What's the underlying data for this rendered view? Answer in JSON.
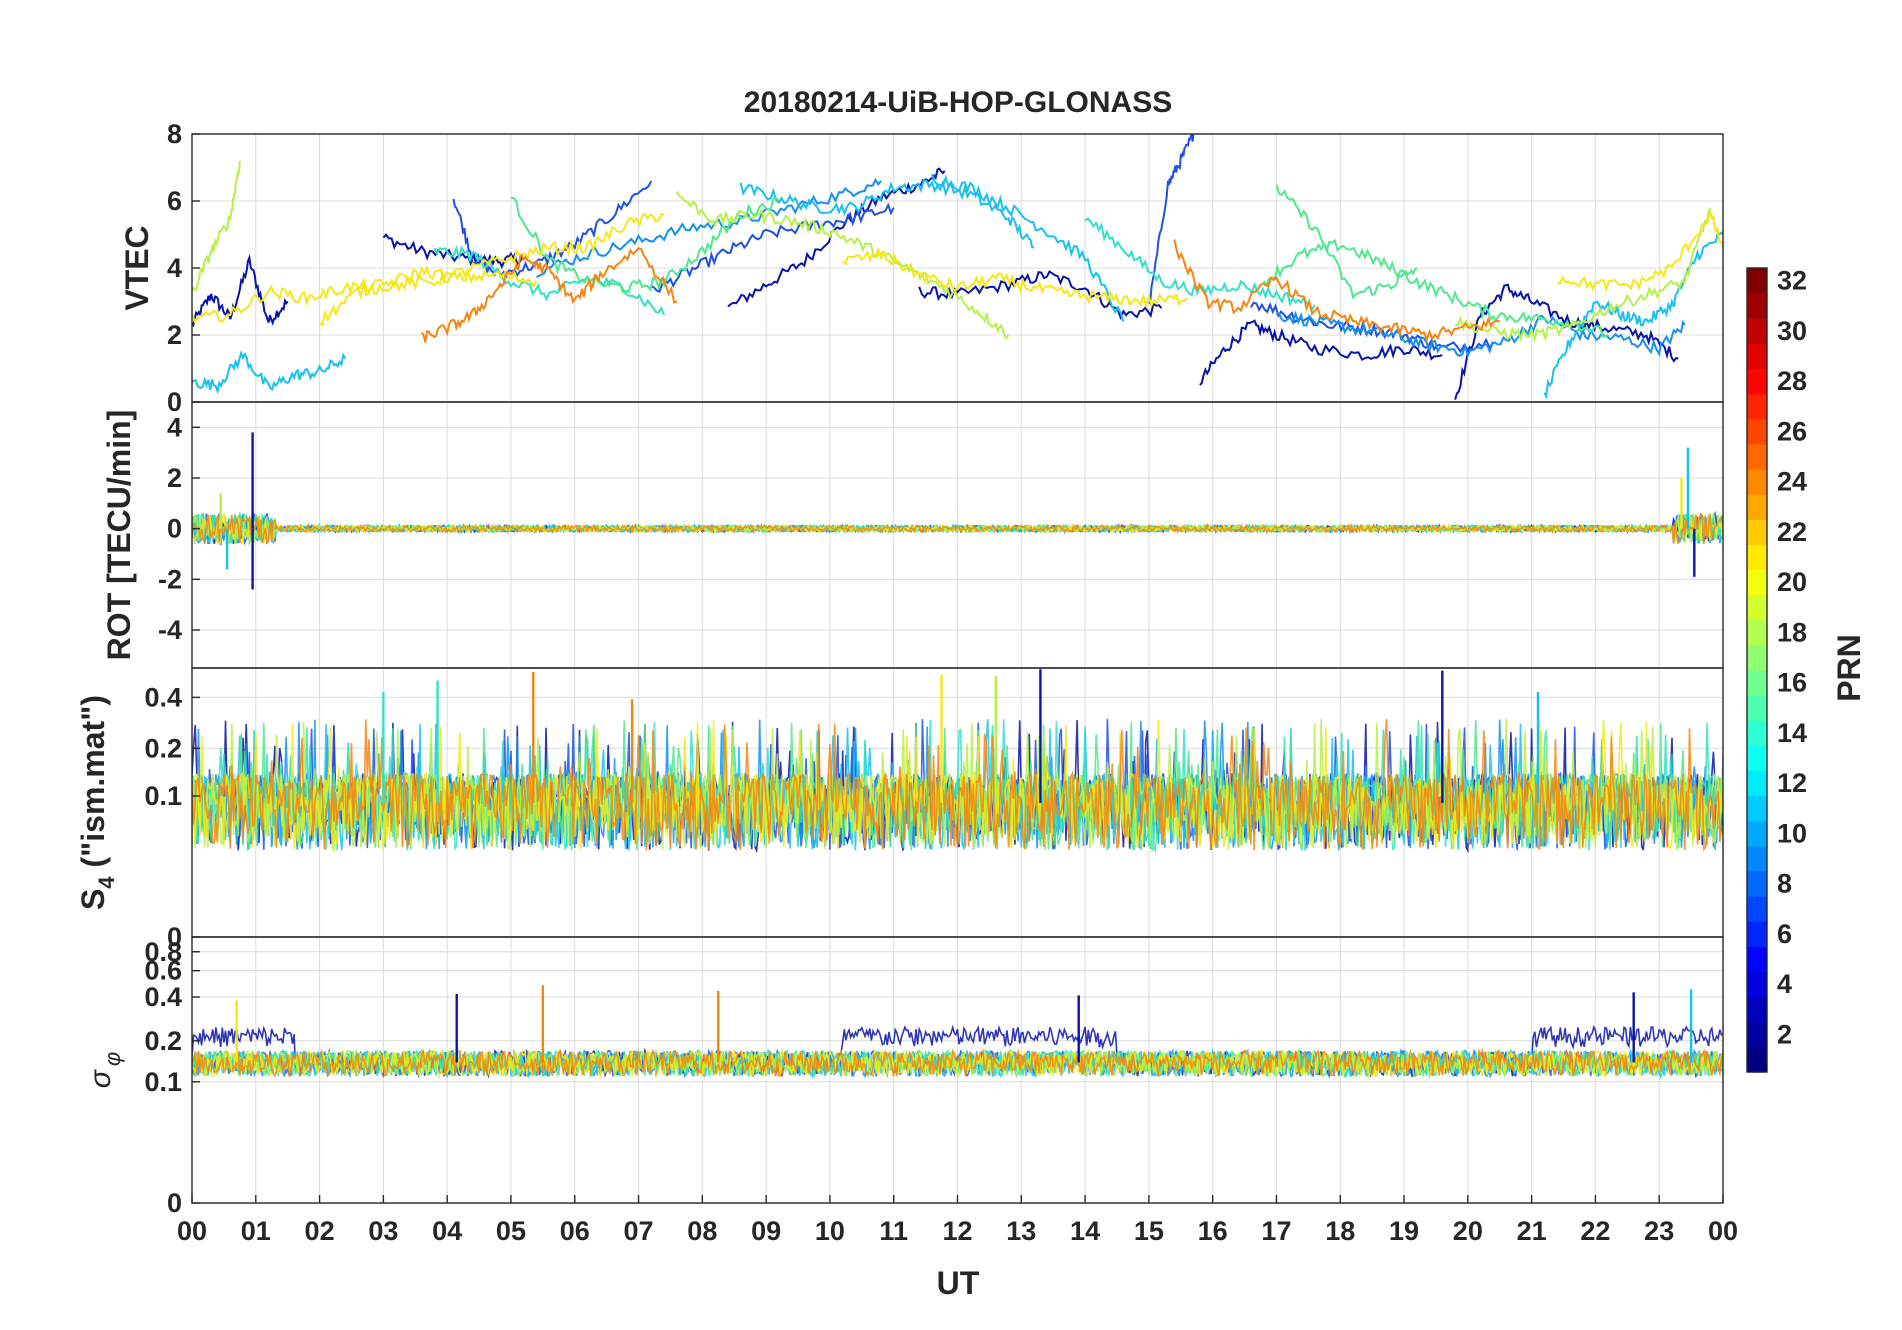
{
  "chart_data": {
    "type": "line",
    "title": "20180214-UiB-HOP-GLONASS",
    "xlabel": "UT",
    "x_ticks": [
      "00",
      "01",
      "02",
      "03",
      "04",
      "05",
      "06",
      "07",
      "08",
      "09",
      "10",
      "11",
      "12",
      "13",
      "14",
      "15",
      "16",
      "17",
      "18",
      "19",
      "20",
      "21",
      "22",
      "23",
      "00"
    ],
    "xlim": [
      0,
      24
    ],
    "colorbar": {
      "label": "PRN",
      "range": [
        1,
        32
      ],
      "ticks": [
        2,
        4,
        6,
        8,
        10,
        12,
        14,
        16,
        18,
        20,
        22,
        24,
        26,
        28,
        30,
        32
      ],
      "colormap": "jet"
    },
    "panels": [
      {
        "id": "vtec",
        "ylabel": "VTEC",
        "ylim": [
          0,
          8
        ],
        "yticks": [
          0,
          2,
          4,
          6,
          8
        ],
        "series": [
          {
            "prn": 2,
            "color": "#0a14a8",
            "x": [
              0.0,
              0.3,
              0.6,
              0.9,
              1.2,
              1.5
            ],
            "y": [
              2.3,
              3.2,
              2.5,
              4.2,
              2.4,
              3.0
            ]
          },
          {
            "prn": 3,
            "color": "#0a14a8",
            "x": [
              3.0,
              3.6,
              4.2,
              4.8,
              5.2
            ],
            "y": [
              4.9,
              4.5,
              4.3,
              4.2,
              4.3
            ]
          },
          {
            "prn": 4,
            "color": "#0a14a8",
            "x": [
              8.4,
              9.0,
              9.6,
              10.2,
              10.8,
              11.4,
              11.8
            ],
            "y": [
              2.8,
              3.5,
              4.2,
              5.3,
              6.1,
              6.5,
              6.9
            ]
          },
          {
            "prn": 5,
            "color": "#0a14a8",
            "x": [
              11.4,
              12.0,
              12.8,
              13.4,
              14.0,
              14.6,
              15.2
            ],
            "y": [
              3.3,
              3.2,
              3.5,
              3.8,
              3.4,
              2.6,
              2.8
            ]
          },
          {
            "prn": 3,
            "color": "#0a14a8",
            "x": [
              15.8,
              16.2,
              16.6,
              17.0,
              17.6,
              18.4,
              19.0,
              19.6
            ],
            "y": [
              0.6,
              1.6,
              2.3,
              2.0,
              1.6,
              1.4,
              1.6,
              1.4
            ]
          },
          {
            "prn": 2,
            "color": "#0a14a8",
            "x": [
              19.8,
              20.2,
              20.6,
              21.0,
              21.6,
              22.2,
              22.8,
              23.3
            ],
            "y": [
              0.1,
              2.6,
              3.4,
              3.0,
              2.4,
              2.2,
              2.0,
              1.3
            ]
          },
          {
            "prn": 7,
            "color": "#1f4fe6",
            "x": [
              4.1,
              4.4,
              4.8,
              5.4,
              6.0,
              6.6,
              7.2
            ],
            "y": [
              6.1,
              4.3,
              3.8,
              4.1,
              4.7,
              5.6,
              6.6
            ]
          },
          {
            "prn": 7,
            "color": "#1f4fe6",
            "x": [
              7.2,
              7.8,
              8.4,
              9.0,
              9.8,
              10.4,
              11.0
            ],
            "y": [
              3.3,
              3.9,
              4.5,
              5.0,
              5.3,
              5.5,
              5.8
            ]
          },
          {
            "prn": 6,
            "color": "#1f4fe6",
            "x": [
              15.0,
              15.3,
              15.5,
              15.7
            ],
            "y": [
              2.8,
              6.5,
              7.2,
              8.0
            ]
          },
          {
            "prn": 7,
            "color": "#1f4fe6",
            "x": [
              16.6,
              17.2,
              17.8,
              18.4,
              19.0,
              19.6,
              20.4
            ],
            "y": [
              3.0,
              2.6,
              2.3,
              2.2,
              2.0,
              1.6,
              1.8
            ]
          },
          {
            "prn": 9,
            "color": "#1590f0",
            "x": [
              5.4,
              6.2,
              7.0,
              7.8,
              8.6,
              9.4,
              10.2,
              10.8
            ],
            "y": [
              3.9,
              4.4,
              4.8,
              5.2,
              5.4,
              5.8,
              6.2,
              6.6
            ]
          },
          {
            "prn": 9,
            "color": "#1590f0",
            "x": [
              17.0,
              17.6,
              18.2,
              18.8,
              19.4,
              20.0,
              20.6,
              21.2,
              21.8,
              22.4,
              23.0,
              23.4
            ],
            "y": [
              2.6,
              2.4,
              2.2,
              2.0,
              1.7,
              1.5,
              1.8,
              2.5,
              2.0,
              1.9,
              1.6,
              2.3
            ]
          },
          {
            "prn": 11,
            "color": "#17c0f0",
            "x": [
              0.0,
              0.4,
              0.8,
              1.2,
              1.6,
              2.0,
              2.4
            ],
            "y": [
              0.6,
              0.5,
              1.4,
              0.4,
              0.8,
              0.9,
              1.3
            ]
          },
          {
            "prn": 11,
            "color": "#17c0f0",
            "x": [
              8.6,
              9.2,
              9.8,
              10.4,
              11.0,
              11.6,
              12.2,
              12.8,
              13.2
            ],
            "y": [
              6.4,
              6.1,
              5.8,
              5.8,
              6.4,
              6.5,
              6.2,
              5.5,
              4.6
            ]
          },
          {
            "prn": 12,
            "color": "#17c0f0",
            "x": [
              11.6,
              12.2,
              12.8,
              13.4,
              14.0,
              14.6
            ],
            "y": [
              6.7,
              6.4,
              5.8,
              5.1,
              4.3,
              2.4
            ]
          },
          {
            "prn": 11,
            "color": "#17c0f0",
            "x": [
              21.2,
              21.6,
              22.0,
              22.4,
              22.8,
              23.2,
              23.6,
              24.0
            ],
            "y": [
              0.2,
              1.8,
              3.0,
              2.6,
              2.4,
              2.9,
              4.4,
              5.0
            ]
          },
          {
            "prn": 13,
            "color": "#30e0c8",
            "x": [
              3.8,
              4.4,
              5.0,
              5.6,
              6.2,
              6.8,
              7.4
            ],
            "y": [
              4.5,
              4.4,
              3.6,
              3.2,
              3.7,
              3.4,
              2.6
            ]
          },
          {
            "prn": 13,
            "color": "#30e0c8",
            "x": [
              14.0,
              14.6,
              15.2,
              15.8,
              16.4,
              17.0,
              17.6
            ],
            "y": [
              5.5,
              4.6,
              3.6,
              3.3,
              3.5,
              3.2,
              2.9
            ]
          },
          {
            "prn": 15,
            "color": "#4fe88c",
            "x": [
              5.0,
              5.6,
              6.2,
              6.8,
              7.4,
              8.0,
              8.6,
              9.2
            ],
            "y": [
              6.1,
              4.2,
              3.6,
              3.4,
              3.6,
              4.5,
              5.6,
              6.0
            ]
          },
          {
            "prn": 15,
            "color": "#4fe88c",
            "x": [
              16.8,
              17.4,
              18.0,
              18.6,
              19.2,
              19.8,
              20.4,
              21.0,
              21.6,
              22.2
            ],
            "y": [
              3.6,
              4.4,
              4.7,
              4.2,
              3.6,
              3.1,
              2.6,
              2.5,
              2.4,
              2.0
            ]
          },
          {
            "prn": 15,
            "color": "#4fe88c",
            "x": [
              17.0,
              17.6,
              18.2,
              18.8,
              19.2
            ],
            "y": [
              6.4,
              5.2,
              3.2,
              3.5,
              4.0
            ]
          },
          {
            "prn": 18,
            "color": "#b6f04a",
            "x": [
              0.0,
              0.3,
              0.6,
              0.75
            ],
            "y": [
              3.2,
              4.5,
              5.5,
              7.2
            ]
          },
          {
            "prn": 18,
            "color": "#b6f04a",
            "x": [
              7.6,
              8.2,
              8.8,
              9.4,
              10.0,
              10.6,
              11.2,
              11.8,
              12.4,
              12.8
            ],
            "y": [
              6.2,
              5.4,
              5.6,
              5.4,
              5.1,
              4.6,
              4.0,
              3.4,
              2.6,
              2.0
            ]
          },
          {
            "prn": 18,
            "color": "#b6f04a",
            "x": [
              19.8,
              20.4,
              21.0,
              21.6,
              22.2,
              22.8,
              23.4,
              23.8
            ],
            "y": [
              2.4,
              2.1,
              2.0,
              2.2,
              2.8,
              3.2,
              3.6,
              5.8
            ]
          },
          {
            "prn": 20,
            "color": "#f5e814",
            "x": [
              0.0,
              0.6,
              1.2,
              1.8,
              2.4,
              3.0,
              3.6,
              4.2,
              4.8,
              5.4
            ],
            "y": [
              2.5,
              2.6,
              3.3,
              3.1,
              3.4,
              3.5,
              3.9,
              3.7,
              3.8,
              3.6
            ]
          },
          {
            "prn": 20,
            "color": "#f5e814",
            "x": [
              2.0,
              2.6,
              3.2,
              3.8,
              4.4,
              5.0,
              5.6,
              6.2,
              6.8,
              7.4
            ],
            "y": [
              2.4,
              3.3,
              3.5,
              3.6,
              4.0,
              4.3,
              4.6,
              4.6,
              5.3,
              5.6
            ]
          },
          {
            "prn": 21,
            "color": "#f5e814",
            "x": [
              10.2,
              10.8,
              11.4,
              12.0,
              12.6,
              13.2,
              13.8,
              14.4,
              15.0,
              15.6
            ],
            "y": [
              4.2,
              4.4,
              3.8,
              3.4,
              3.7,
              3.4,
              3.2,
              3.1,
              3.0,
              3.1
            ]
          },
          {
            "prn": 21,
            "color": "#f5e814",
            "x": [
              21.4,
              22.0,
              22.6,
              23.2,
              23.8,
              24.0
            ],
            "y": [
              3.7,
              3.5,
              3.5,
              4.0,
              5.6,
              4.6
            ]
          },
          {
            "prn": 24,
            "color": "#f5850f",
            "x": [
              3.6,
              4.0,
              4.4,
              4.8,
              5.2,
              5.6,
              6.0,
              6.4,
              7.0,
              7.6
            ],
            "y": [
              1.9,
              2.2,
              2.6,
              3.4,
              4.3,
              3.9,
              3.0,
              3.8,
              4.6,
              3.0
            ]
          },
          {
            "prn": 24,
            "color": "#f5850f",
            "x": [
              15.4,
              15.9,
              16.4,
              17.0,
              17.6,
              18.2,
              18.8,
              19.4,
              20.0,
              20.5
            ],
            "y": [
              4.7,
              3.0,
              2.8,
              3.7,
              2.7,
              2.4,
              2.2,
              2.0,
              2.2,
              2.4
            ]
          }
        ]
      },
      {
        "id": "rot",
        "ylabel": "ROT [TECU/min]",
        "ylim": [
          -5.5,
          5
        ],
        "yticks": [
          -4,
          -2,
          0,
          2,
          4
        ],
        "spikes": [
          {
            "prn": 2,
            "color": "#0a14a8",
            "x": 0.95,
            "y": 3.8
          },
          {
            "prn": 2,
            "color": "#0a14a8",
            "x": 0.95,
            "y": -2.4
          },
          {
            "prn": 18,
            "color": "#b6f04a",
            "x": 0.45,
            "y": 1.4
          },
          {
            "prn": 11,
            "color": "#17c0f0",
            "x": 0.55,
            "y": -1.6
          },
          {
            "prn": 11,
            "color": "#17c0f0",
            "x": 23.45,
            "y": 3.2
          },
          {
            "prn": 20,
            "color": "#f5e814",
            "x": 23.35,
            "y": 2.0
          },
          {
            "prn": 2,
            "color": "#0a14a8",
            "x": 23.55,
            "y": -1.9
          }
        ]
      },
      {
        "id": "s4",
        "ylabel": "S4 (\"ism.mat\")",
        "ylabel_main": "S",
        "ylabel_sub": "4",
        "ylabel_rest": " (\"ism.mat\")",
        "ylim": [
          0,
          0.59
        ],
        "yticks": [
          0,
          0.1,
          0.2,
          0.4
        ],
        "scale": "log",
        "peaks": [
          {
            "prn": 2,
            "color": "#0a14a8",
            "x": 13.3,
            "y": 0.58
          },
          {
            "prn": 2,
            "color": "#0a14a8",
            "x": 19.6,
            "y": 0.57
          },
          {
            "prn": 24,
            "color": "#f5850f",
            "x": 5.35,
            "y": 0.56
          },
          {
            "prn": 20,
            "color": "#f5e814",
            "x": 11.75,
            "y": 0.54
          },
          {
            "prn": 13,
            "color": "#30e0c8",
            "x": 3.85,
            "y": 0.5
          },
          {
            "prn": 13,
            "color": "#30e0c8",
            "x": 3.0,
            "y": 0.43
          },
          {
            "prn": 24,
            "color": "#f5850f",
            "x": 6.9,
            "y": 0.39
          },
          {
            "prn": 11,
            "color": "#17c0f0",
            "x": 21.1,
            "y": 0.43
          },
          {
            "prn": 18,
            "color": "#b6f04a",
            "x": 12.6,
            "y": 0.53
          }
        ]
      },
      {
        "id": "sigma_phi",
        "ylabel": "σφ",
        "ylim": [
          0,
          1.0
        ],
        "yticks": [
          0,
          0.1,
          0.2,
          0.4,
          0.6,
          0.8
        ],
        "scale": "log",
        "peaks": [
          {
            "prn": 24,
            "color": "#f5850f",
            "x": 5.5,
            "y": 0.48
          },
          {
            "prn": 24,
            "color": "#f5850f",
            "x": 8.25,
            "y": 0.44
          },
          {
            "prn": 11,
            "color": "#17c0f0",
            "x": 23.5,
            "y": 0.45
          },
          {
            "prn": 2,
            "color": "#0a14a8",
            "x": 4.15,
            "y": 0.42
          },
          {
            "prn": 2,
            "color": "#0a14a8",
            "x": 22.6,
            "y": 0.43
          },
          {
            "prn": 2,
            "color": "#0a14a8",
            "x": 13.9,
            "y": 0.41
          },
          {
            "prn": 20,
            "color": "#f5e814",
            "x": 0.7,
            "y": 0.38
          }
        ]
      }
    ]
  }
}
